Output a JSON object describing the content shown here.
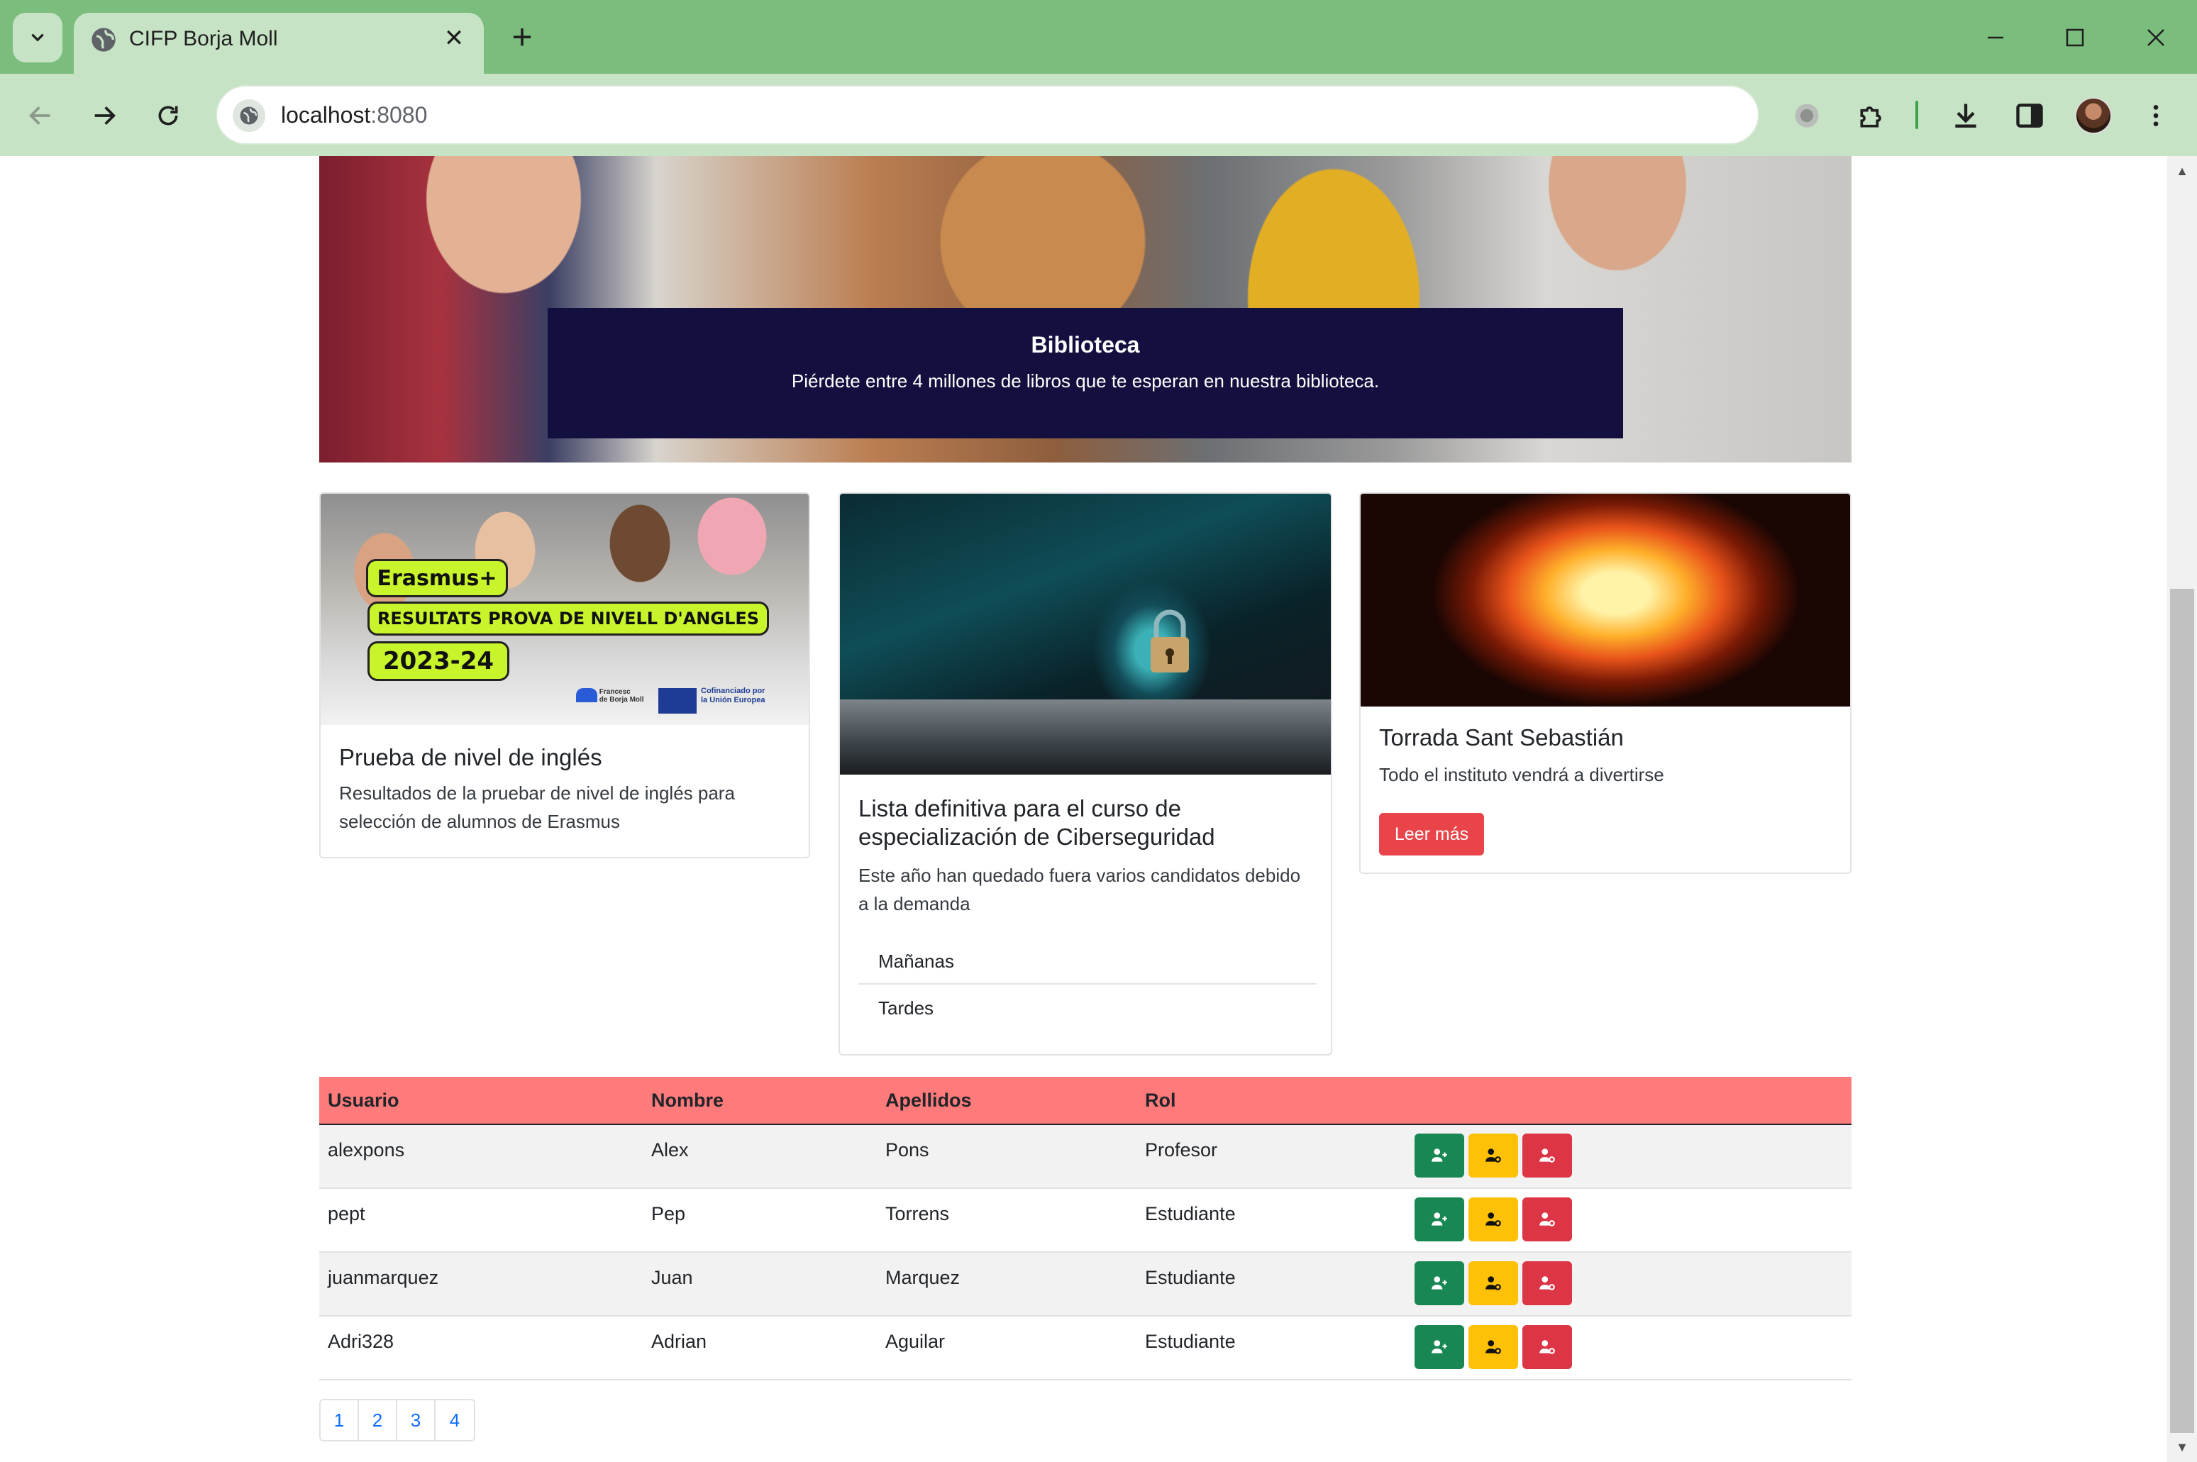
{
  "browser": {
    "tab_title": "CIFP Borja Moll",
    "url_host": "localhost",
    "url_port": ":8080"
  },
  "carousel": {
    "caption_title": "Biblioteca",
    "caption_text": "Piérdete entre 4 millones de libros que te esperan en nuestra biblioteca."
  },
  "cards": [
    {
      "title": "Prueba de nivel de inglés",
      "text_line1": "Resultados de la pruebar de nivel de inglés para",
      "text_line2": "selección de alumnos de Erasmus",
      "image_text": {
        "brand": "Erasmus+",
        "headline": "RESULTATS PROVA DE NIVELL D'ANGLES",
        "year": "2023-24",
        "eu_line1": "Cofinanciado por",
        "eu_line2": "la Unión Europea",
        "school_line1": "Francesc",
        "school_line2": "de Borja Moll"
      }
    },
    {
      "title_line1": "Lista definitiva para el curso de",
      "title_line2": "especialización de Ciberseguridad",
      "text_line1": "Este año han quedado fuera varios candidatos debido",
      "text_line2": "a la demanda",
      "list": [
        "Mañanas",
        "Tardes"
      ]
    },
    {
      "title": "Torrada Sant Sebastián",
      "text": "Todo el instituto vendrá a divertirse",
      "button_label": "Leer más"
    }
  ],
  "table": {
    "headers": [
      "Usuario",
      "Nombre",
      "Apellidos",
      "Rol"
    ],
    "rows": [
      {
        "usuario": "alexpons",
        "nombre": "Alex",
        "apellidos": "Pons",
        "rol": "Profesor"
      },
      {
        "usuario": "pept",
        "nombre": "Pep",
        "apellidos": "Torrens",
        "rol": "Estudiante"
      },
      {
        "usuario": "juanmarquez",
        "nombre": "Juan",
        "apellidos": "Marquez",
        "rol": "Estudiante"
      },
      {
        "usuario": "Adri328",
        "nombre": "Adrian",
        "apellidos": "Aguilar",
        "rol": "Estudiante"
      }
    ],
    "actions": [
      "add-user-icon",
      "edit-user-icon",
      "delete-user-icon"
    ]
  },
  "pagination": [
    "1",
    "2",
    "3",
    "4"
  ],
  "colors": {
    "browser_frame": "#7bbd7c",
    "caption_bg": "#13103f",
    "table_header": "#ff7b7b",
    "btn_success": "#198754",
    "btn_warning": "#ffc107",
    "btn_danger": "#dc3545",
    "btn_leer": "#e8444a"
  }
}
